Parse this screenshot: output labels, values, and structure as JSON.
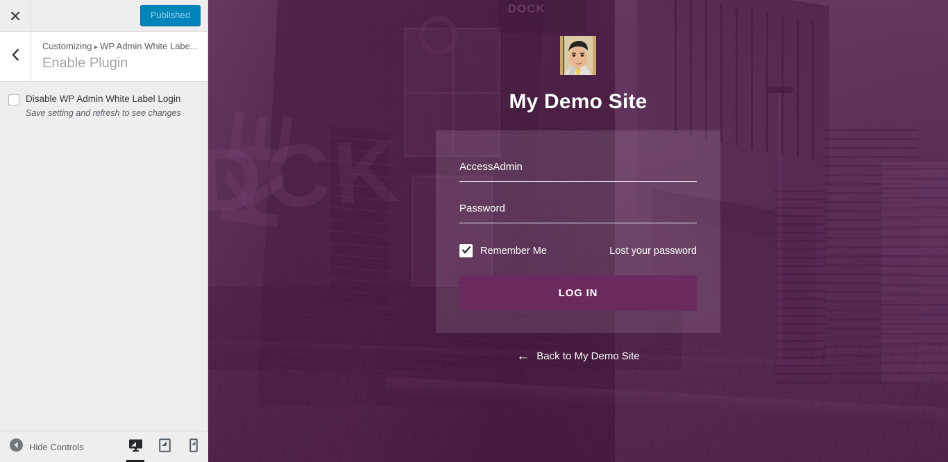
{
  "customizer": {
    "close_icon": "close-x-icon",
    "publish_button": "Published",
    "back_icon": "chevron-left-icon",
    "breadcrumb_root": "Customizing",
    "breadcrumb_separator": "▸",
    "breadcrumb_panel": "WP Admin White Labe...",
    "section_title": "Enable Plugin",
    "controls": [
      {
        "label": "Disable WP Admin White Label Login",
        "description": "Save setting and refresh to see changes",
        "checked": false
      }
    ],
    "footer": {
      "hide_controls_label": "Hide Controls",
      "hide_controls_icon": "collapse-left-circle-icon",
      "devices": [
        {
          "name": "desktop",
          "icon": "desktop-icon",
          "active": true
        },
        {
          "name": "tablet",
          "icon": "tablet-icon",
          "active": false
        },
        {
          "name": "mobile",
          "icon": "mobile-icon",
          "active": false
        }
      ]
    }
  },
  "preview": {
    "logo_alt": "site-logo-avatar",
    "site_title": "My Demo Site",
    "form": {
      "username_value": "AccessAdmin",
      "username_placeholder": "AccessAdmin",
      "password_value": "",
      "password_placeholder": "Password",
      "remember_label": "Remember Me",
      "remember_checked": true,
      "lost_password_label": "Lost your password",
      "submit_label": "LOG IN"
    },
    "back_link": {
      "arrow": "←",
      "label": "Back to My Demo Site",
      "icon": "arrow-left-icon"
    }
  },
  "colors": {
    "accent_blue": "#0085ba",
    "login_button": "#6b2a5e",
    "overlay_purple": "#6a1e5f",
    "sidebar_bg": "#eeeeee"
  }
}
